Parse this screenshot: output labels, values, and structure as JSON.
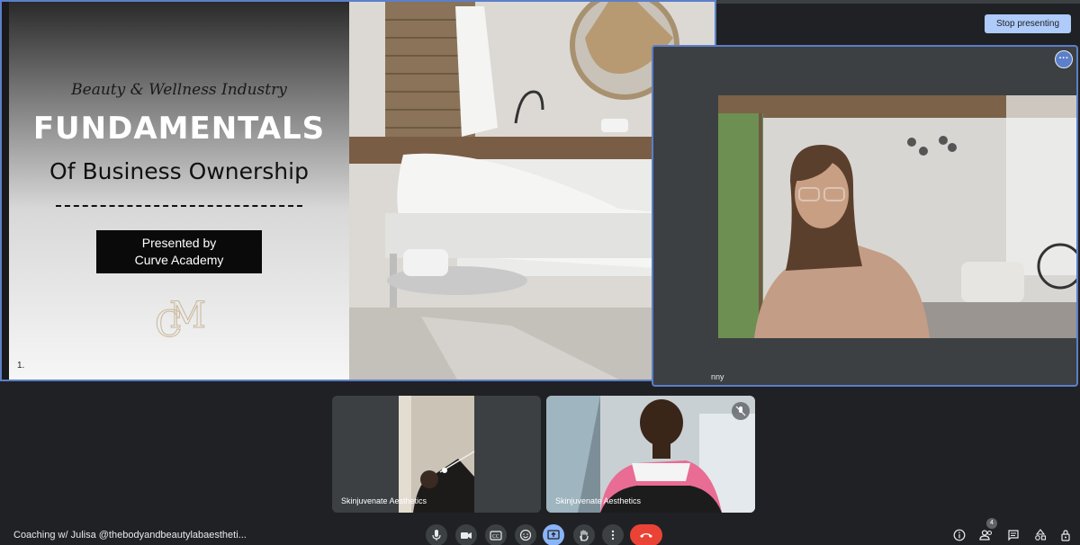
{
  "presenting": {
    "stop_label": "Stop presenting"
  },
  "slide": {
    "industry": "Beauty & Wellness Industry",
    "title": "FUNDAMENTALS",
    "subtitle": "Of Business Ownership",
    "presented_line1": "Presented by",
    "presented_line2": "Curve Academy",
    "logo_text": "CM",
    "page_number": "1."
  },
  "speaker": {
    "name_fragment": "nny",
    "more_icon": "more-horiz-icon"
  },
  "tiles": [
    {
      "name": "Skinjuvenate Aesthetics",
      "muted": false
    },
    {
      "name": "Skinjuvenate Aesthetics",
      "muted": true
    }
  ],
  "meeting": {
    "title": "Coaching w/ Julisa @thebodyandbeautylabaestheti..."
  },
  "controls": {
    "center": [
      "mic-icon",
      "camera-icon",
      "captions-icon",
      "emoji-icon",
      "present-icon",
      "raise-hand-icon",
      "more-vert-icon",
      "end-call-icon"
    ],
    "right": [
      "info-icon",
      "people-icon",
      "chat-icon",
      "activities-icon",
      "host-controls-icon"
    ],
    "participant_count": "4"
  },
  "colors": {
    "accent": "#8ab4f8",
    "end_call": "#ea4335",
    "frame_border": "#5b7fc9",
    "background": "#202124"
  }
}
